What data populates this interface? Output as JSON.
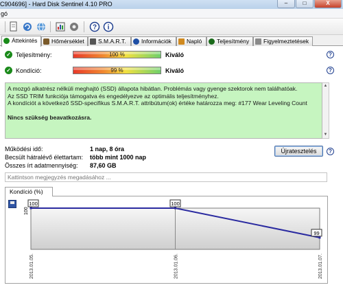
{
  "window": {
    "title": "C904696] - Hard Disk Sentinel 4.10 PRO",
    "min": "–",
    "max": "□",
    "close": "X"
  },
  "menu": {
    "item": "gó"
  },
  "toolbar": {
    "icons": [
      "document-icon",
      "refresh-icon",
      "network-icon",
      "report-icon",
      "settings-icon",
      "help-icon",
      "info-icon"
    ]
  },
  "tabs": [
    {
      "label": "Áttekintés",
      "icon_color": "#1a8a1a"
    },
    {
      "label": "Hőmérséklet",
      "icon_color": "#7a5a2a"
    },
    {
      "label": "S.M.A.R.T.",
      "icon_color": "#555555"
    },
    {
      "label": "Információk",
      "icon_color": "#1f4fa5"
    },
    {
      "label": "Napló",
      "icon_color": "#d08a20"
    },
    {
      "label": "Teljesítmény",
      "icon_color": "#1a6a1a"
    },
    {
      "label": "Figyelmeztetések",
      "icon_color": "#8a8a8a"
    }
  ],
  "health": {
    "performance_label": "Teljesítmény:",
    "performance_value": "100 %",
    "performance_fraction": 1.0,
    "performance_rating": "Kiváló",
    "condition_label": "Kondíció:",
    "condition_value": "99 %",
    "condition_fraction": 0.99,
    "condition_rating": "Kiváló"
  },
  "status_text": {
    "line1": "A mozgó alkatrész nélküli meghajtó (SSD) állapota hibátlan. Problémás vagy gyenge szektorok nem találhatóak.",
    "line2": "Az SSD TRIM funkciója támogatva és engedélyezve az optimális teljesítményhez.",
    "line3": "A kondíciót a következő SSD-specifikus S.M.A.R.T. attribútum(ok) értéke határozza meg:  #177 Wear Leveling Count",
    "line4": "Nincs szükség beavatkozásra."
  },
  "details": {
    "uptime_label": "Működési idő:",
    "uptime_value": "1 nap, 8 óra",
    "lifetime_label": "Becsült hátralévő élettartam:",
    "lifetime_value": "több mint 1000 nap",
    "written_label": "Összes írt adatmennyiség:",
    "written_value": "87,60 GB"
  },
  "retest_button": "Újratesztelés",
  "note_placeholder": "Kattintson megjegyzés megadásához ...",
  "graph_tab": "Kondíció  (%)",
  "chart_data": {
    "type": "line",
    "x": [
      "2013.01.05.",
      "2013.01.06.",
      "2013.01.07."
    ],
    "values": [
      100,
      100,
      99
    ],
    "data_labels": [
      "100",
      "100",
      "99"
    ],
    "y_tick_label": "100",
    "color": "#2a2aa0"
  },
  "colors": {
    "status_green": "#c6f5c0",
    "ok_green": "#1a8a1a",
    "help_blue": "#1f3f8f"
  }
}
